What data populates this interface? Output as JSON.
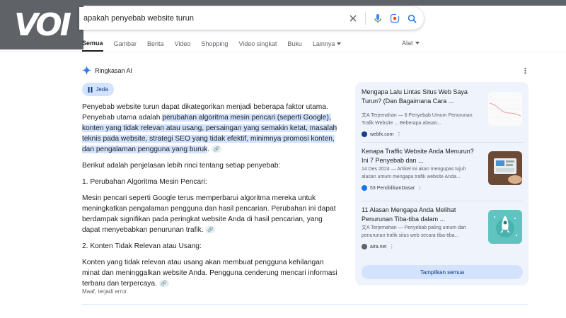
{
  "logo": {
    "text": "VOI"
  },
  "search": {
    "query": "apakah penyebab website turun"
  },
  "tabs": [
    {
      "label": "Semua",
      "active": true
    },
    {
      "label": "Gambar"
    },
    {
      "label": "Berita"
    },
    {
      "label": "Video"
    },
    {
      "label": "Shopping"
    },
    {
      "label": "Video singkat"
    },
    {
      "label": "Buku"
    },
    {
      "label": "Lainnya"
    }
  ],
  "tools_label": "Alat",
  "ai_overview": {
    "title": "Ringkasan AI",
    "pause_label": "Jeda",
    "intro_plain": "Penyebab website turun dapat dikategorikan menjadi beberapa faktor utama. Penyebab utama adalah ",
    "intro_highlight": "perubahan algoritma mesin pencari (seperti Google), konten yang tidak relevan atau usang, persaingan yang semakin ketat, masalah teknis pada website, strategi SEO yang tidak efektif, minimnya promosi konten, dan pengalaman pengguna yang buruk",
    "intro_end": ".",
    "explain": "Berikut adalah penjelasan lebih rinci tentang setiap penyebab:",
    "section1_title": "1. Perubahan Algoritma Mesin Pencari:",
    "section1_body": "Mesin pencari seperti Google terus memperbarui algoritma mereka untuk meningkatkan pengalaman pengguna dan hasil pencarian. Perubahan ini dapat berdampak signifikan pada peringkat website Anda di hasil pencarian, yang dapat menyebabkan penurunan trafik.",
    "section2_title": "2. Konten Tidak Relevan atau Usang:",
    "section2_body": "Konten yang tidak relevan atau usang akan membuat pengguna kehilangan minat dan meninggalkan website Anda. Pengguna cenderung mencari informasi terbaru dan terpercaya.",
    "error": "Maaf, terjadi error."
  },
  "sources": [
    {
      "title": "Mengapa Lalu Lintas Situs Web Saya Turun? (Dan Bagaimana Cara ...",
      "snippet": "Terjemahan — 6 Penyebab Umum Penurunan Trafik Website ... Beberapa alasan...",
      "site": "webfx.com",
      "favicon_color": "#1a3d8f"
    },
    {
      "title": "Kenapa Traffic Website Anda Menurun? Ini 7 Penyebab dan ...",
      "snippet": "14 Des 2024 — Artikel ini akan mengupas tujuh alasan umum mengapa trafik website Anda...",
      "site": "53 PendidikanDasar",
      "favicon_color": "#1a73e8"
    },
    {
      "title": "11 Alasan Mengapa Anda Melihat Penurunan Tiba-tiba dalam ...",
      "snippet": "Terjemahan — Penyebab paling umum dari penurunan trafik situs web secara tiba-tiba...",
      "site": "aira.net",
      "favicon_color": "#5f6368"
    }
  ],
  "show_all_label": "Tampilkan semua",
  "colors": {
    "accent": "#1a73e8",
    "highlight": "#d3e3fd",
    "panel": "#eef3fc"
  }
}
